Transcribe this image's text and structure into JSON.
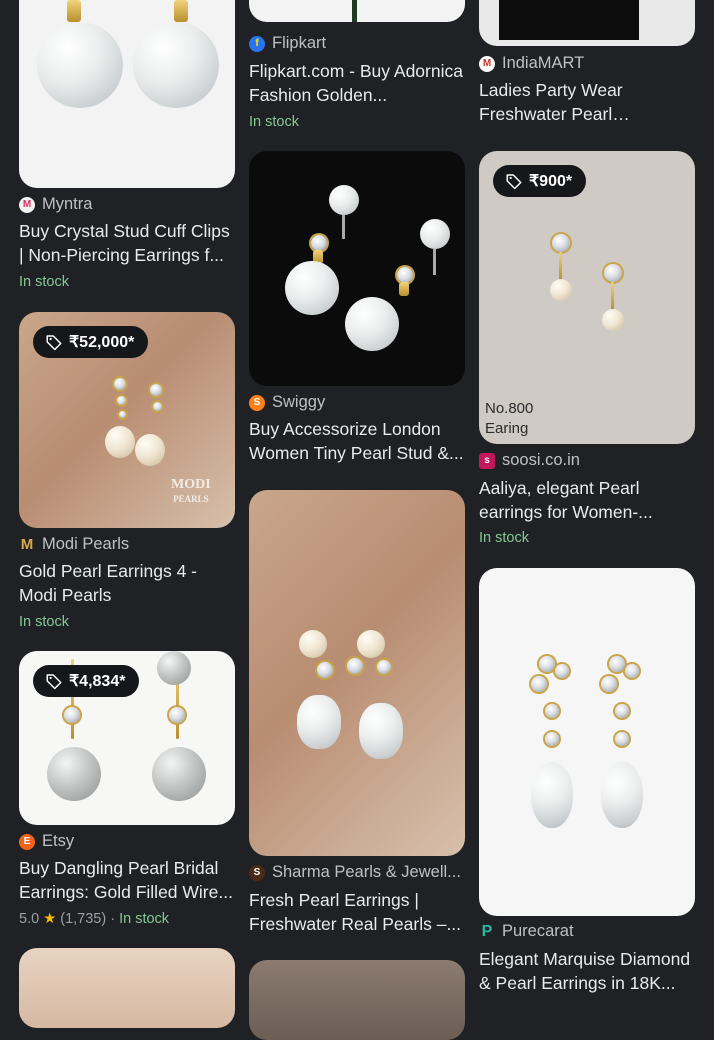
{
  "results": {
    "col1": [
      {
        "source": "Myntra",
        "title": "Buy Crystal Stud Cuff Clips | Non-Piercing Earrings f...",
        "stock": "In stock",
        "favicon_color": "#f2f2f2"
      },
      {
        "price": "₹52,000*",
        "source": "Modi Pearls",
        "title": "Gold Pearl Earrings 4 - Modi Pearls",
        "stock": "In stock",
        "watermark_line1": "MODI",
        "watermark_line2": "PEARLS"
      },
      {
        "price": "₹4,834*",
        "source": "Etsy",
        "title": "Buy Dangling Pearl Bridal Earrings: Gold Filled Wire...",
        "rating": "5.0",
        "star": "★",
        "reviews": "(1,735)",
        "separator": "·",
        "stock": "In stock"
      }
    ],
    "col2": [
      {
        "source": "Flipkart",
        "title": "Flipkart.com - Buy Adornica Fashion Golden...",
        "stock": "In stock"
      },
      {
        "source": "Swiggy",
        "title": "Buy Accessorize London Women Tiny Pearl Stud &...",
        "stock": ""
      },
      {
        "source": "Sharma Pearls & Jewell...",
        "title": "Fresh Pearl Earrings | Freshwater Real Pearls –...",
        "stock": ""
      }
    ],
    "col3": [
      {
        "source": "IndiaMART",
        "title": "Ladies Party Wear Freshwater Pearl Earrings...",
        "stock": ""
      },
      {
        "price": "₹900*",
        "source": "soosi.co.in",
        "title": "Aaliya, elegant Pearl earrings for Women-...",
        "stock": "In stock",
        "image_text_1": "No.800",
        "image_text_2": "Earing"
      },
      {
        "source": "Purecarat",
        "title": "Elegant Marquise Diamond & Pearl Earrings in 18K...",
        "stock": ""
      }
    ]
  },
  "favicons": {
    "myntra": "M",
    "flipkart": "f",
    "indiamart": "M",
    "modi": "M",
    "swiggy": "S",
    "soosi": "s",
    "etsy": "E",
    "sharma": "S",
    "purecarat": "P"
  },
  "colors": {
    "background": "#202124",
    "title": "#e8eaed",
    "source": "#bdc1c6",
    "in_stock": "#81c995",
    "price_pill": "#16171a"
  }
}
